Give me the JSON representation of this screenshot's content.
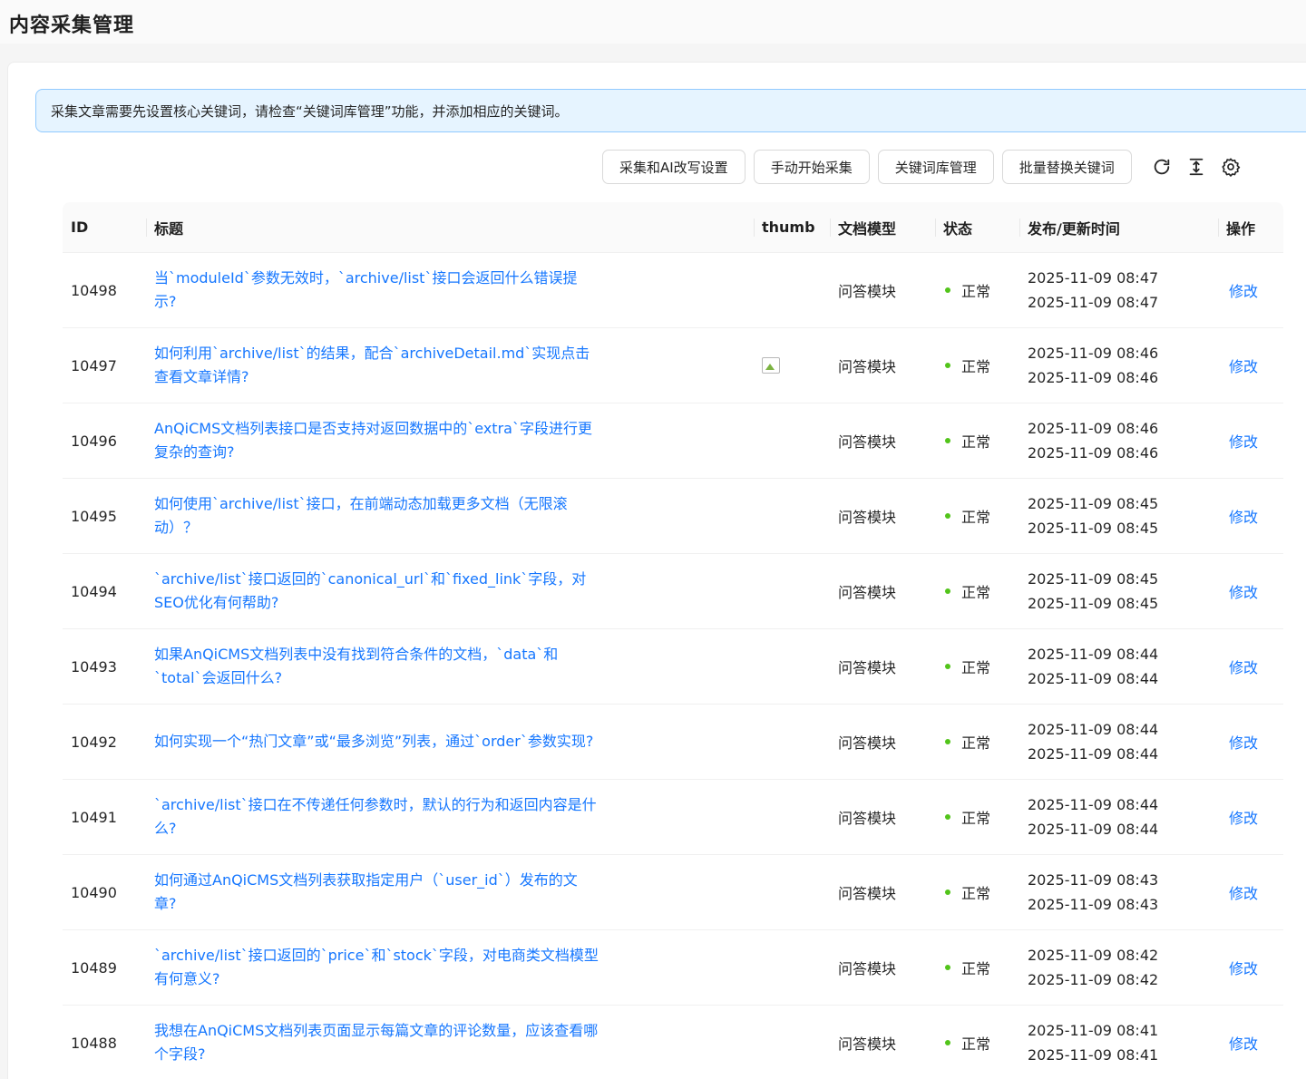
{
  "page": {
    "title": "内容采集管理"
  },
  "alert": {
    "text": "采集文章需要先设置核心关键词，请检查“关键词库管理”功能，并添加相应的关键词。"
  },
  "toolbar": {
    "buttons": [
      "采集和AI改写设置",
      "手动开始采集",
      "关键词库管理",
      "批量替换关键词"
    ],
    "icons": [
      "reload-icon",
      "column-height-icon",
      "setting-icon"
    ]
  },
  "table": {
    "columns": [
      "ID",
      "标题",
      "thumb",
      "文档模型",
      "状态",
      "发布/更新时间",
      "操作"
    ],
    "rows": [
      {
        "id": "10498",
        "title": "当`moduleId`参数无效时，`archive/list`接口会返回什么错误提示?",
        "thumb": false,
        "model": "问答模块",
        "status": "正常",
        "publish": "2025-11-09 08:47",
        "update": "2025-11-09 08:47",
        "op": "修改"
      },
      {
        "id": "10497",
        "title": "如何利用`archive/list`的结果，配合`archiveDetail.md`实现点击查看文章详情?",
        "thumb": true,
        "model": "问答模块",
        "status": "正常",
        "publish": "2025-11-09 08:46",
        "update": "2025-11-09 08:46",
        "op": "修改"
      },
      {
        "id": "10496",
        "title": "AnQiCMS文档列表接口是否支持对返回数据中的`extra`字段进行更复杂的查询?",
        "thumb": false,
        "model": "问答模块",
        "status": "正常",
        "publish": "2025-11-09 08:46",
        "update": "2025-11-09 08:46",
        "op": "修改"
      },
      {
        "id": "10495",
        "title": "如何使用`archive/list`接口，在前端动态加载更多文档（无限滚动）？",
        "thumb": false,
        "model": "问答模块",
        "status": "正常",
        "publish": "2025-11-09 08:45",
        "update": "2025-11-09 08:45",
        "op": "修改"
      },
      {
        "id": "10494",
        "title": "`archive/list`接口返回的`canonical_url`和`fixed_link`字段，对SEO优化有何帮助?",
        "thumb": false,
        "model": "问答模块",
        "status": "正常",
        "publish": "2025-11-09 08:45",
        "update": "2025-11-09 08:45",
        "op": "修改"
      },
      {
        "id": "10493",
        "title": "如果AnQiCMS文档列表中没有找到符合条件的文档，`data`和`total`会返回什么?",
        "thumb": false,
        "model": "问答模块",
        "status": "正常",
        "publish": "2025-11-09 08:44",
        "update": "2025-11-09 08:44",
        "op": "修改"
      },
      {
        "id": "10492",
        "title": "如何实现一个“热门文章”或“最多浏览”列表，通过`order`参数实现?",
        "thumb": false,
        "model": "问答模块",
        "status": "正常",
        "publish": "2025-11-09 08:44",
        "update": "2025-11-09 08:44",
        "op": "修改"
      },
      {
        "id": "10491",
        "title": "`archive/list`接口在不传递任何参数时，默认的行为和返回内容是什么?",
        "thumb": false,
        "model": "问答模块",
        "status": "正常",
        "publish": "2025-11-09 08:44",
        "update": "2025-11-09 08:44",
        "op": "修改"
      },
      {
        "id": "10490",
        "title": "如何通过AnQiCMS文档列表获取指定用户（`user_id`）发布的文章?",
        "thumb": false,
        "model": "问答模块",
        "status": "正常",
        "publish": "2025-11-09 08:43",
        "update": "2025-11-09 08:43",
        "op": "修改"
      },
      {
        "id": "10489",
        "title": "`archive/list`接口返回的`price`和`stock`字段，对电商类文档模型有何意义?",
        "thumb": false,
        "model": "问答模块",
        "status": "正常",
        "publish": "2025-11-09 08:42",
        "update": "2025-11-09 08:42",
        "op": "修改"
      },
      {
        "id": "10488",
        "title": "我想在AnQiCMS文档列表页面显示每篇文章的评论数量，应该查看哪个字段?",
        "thumb": false,
        "model": "问答模块",
        "status": "正常",
        "publish": "2025-11-09 08:41",
        "update": "2025-11-09 08:41",
        "op": "修改"
      }
    ]
  },
  "colors": {
    "primary": "#1677ff",
    "success": "#52c41a",
    "alert_bg": "#e6f4ff",
    "alert_border": "#91caff"
  }
}
